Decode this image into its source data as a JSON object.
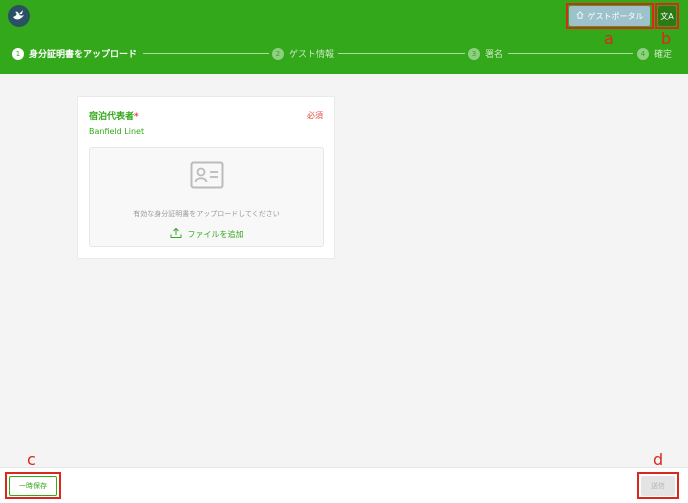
{
  "header": {
    "logo_icon": "bird-logo-icon",
    "portal_icon": "home-icon",
    "portal_label": "ゲストポータル",
    "lang_icon": "translate-icon",
    "lang_label": "文A"
  },
  "steps": [
    {
      "num": "1",
      "label": "身分証明書をアップロード",
      "state": "active"
    },
    {
      "num": "2",
      "label": "ゲスト情報",
      "state": "inactive"
    },
    {
      "num": "3",
      "label": "署名",
      "state": "inactive"
    },
    {
      "num": "4",
      "label": "確定",
      "state": "inactive"
    }
  ],
  "card": {
    "title": "宿泊代表者",
    "required_mark": "*",
    "required_label": "必須",
    "guest_name": "Banfield Linet",
    "dropzone_icon": "id-card-icon",
    "hint": "有効な身分証明書をアップロードしてください",
    "add_file_icon": "upload-icon",
    "add_file_label": "ファイルを追加"
  },
  "footer": {
    "save_label": "一時保存",
    "send_label": "送信"
  },
  "annotations": [
    "a",
    "b",
    "c",
    "d"
  ],
  "colors": {
    "brand_green": "#33a81a",
    "annotation_red": "#d9291b",
    "required_red": "#e04b3c"
  }
}
